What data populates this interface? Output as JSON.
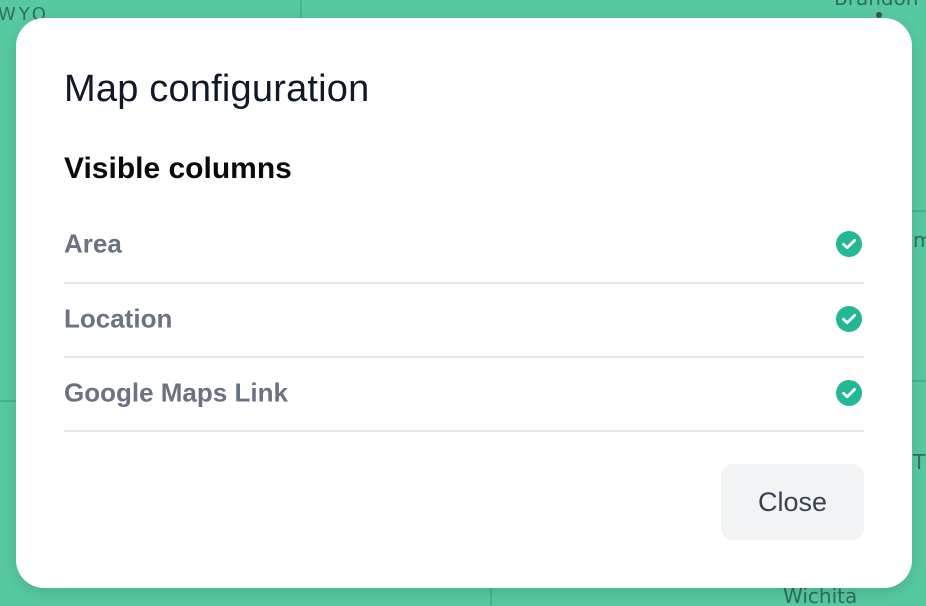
{
  "background_map": {
    "labels": [
      "WYO",
      "Brandon",
      "Wichita",
      "m",
      "T"
    ]
  },
  "modal": {
    "title": "Map configuration",
    "section_title": "Visible columns",
    "columns": [
      {
        "label": "Area",
        "checked": true,
        "icon": "check-circle-icon"
      },
      {
        "label": "Location",
        "checked": true,
        "icon": "check-circle-icon"
      },
      {
        "label": "Google Maps Link",
        "checked": true,
        "icon": "check-circle-icon"
      }
    ],
    "close_label": "Close"
  },
  "colors": {
    "map_background": "#56c9a0",
    "check_accent": "#22b893",
    "modal_background": "#ffffff",
    "button_background": "#f2f3f5"
  }
}
